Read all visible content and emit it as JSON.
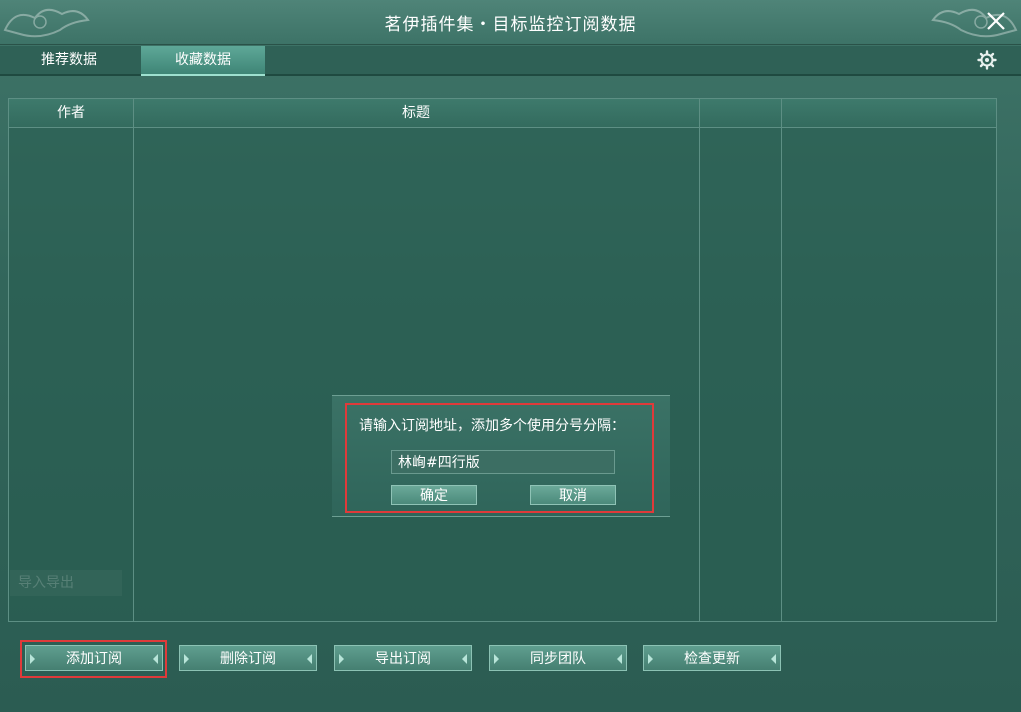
{
  "window": {
    "title": "茗伊插件集・目标监控订阅数据"
  },
  "tabs": [
    {
      "label": "推荐数据",
      "active": false
    },
    {
      "label": "收藏数据",
      "active": true
    }
  ],
  "table": {
    "columns": [
      "作者",
      "标题",
      "",
      ""
    ],
    "rows": []
  },
  "background_hint": {
    "label": "导入导出"
  },
  "dialog": {
    "prompt": "请输入订阅地址，添加多个使用分号分隔：",
    "input_value": "林峋#四行版",
    "ok_label": "确定",
    "cancel_label": "取消"
  },
  "actions": [
    {
      "label": "添加订阅"
    },
    {
      "label": "删除订阅"
    },
    {
      "label": "导出订阅"
    },
    {
      "label": "同步团队"
    },
    {
      "label": "检查更新"
    }
  ],
  "icons": {
    "close": "close-icon",
    "settings": "gear-icon"
  },
  "colors": {
    "highlight": "#e03a3a",
    "panel": "#32665b",
    "active_tab": "#5ea898"
  }
}
